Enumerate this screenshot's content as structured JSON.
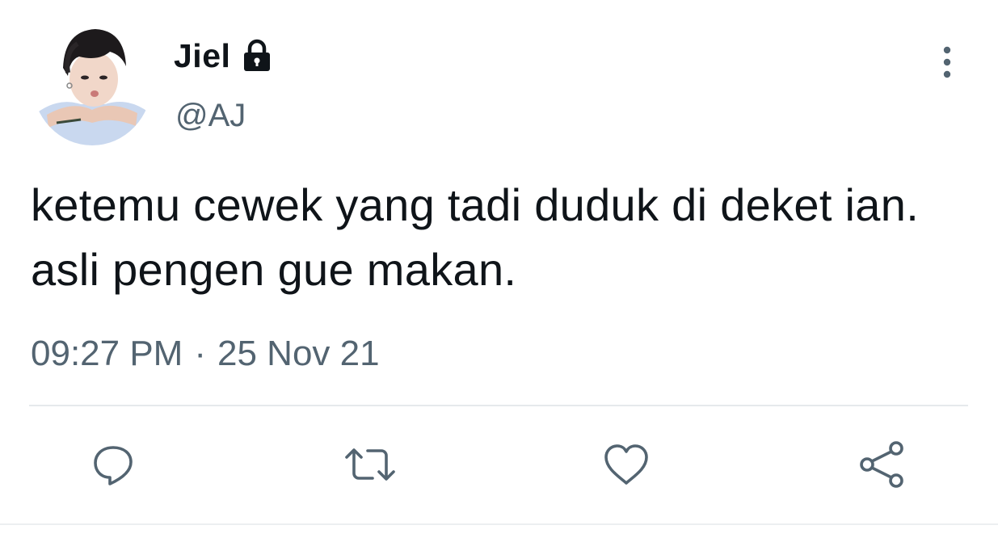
{
  "user": {
    "display_name": "Jiel",
    "handle": "@AJ",
    "protected_icon": "lock-icon",
    "avatar_icon": "avatar-photo"
  },
  "tweet": {
    "text": "ketemu cewek yang tadi duduk di deket ian. asli pengen gue makan.",
    "time": "09:27 PM",
    "separator": "·",
    "date": "25 Nov 21"
  },
  "actions": [
    {
      "name": "reply",
      "icon": "reply-icon"
    },
    {
      "name": "retweet",
      "icon": "retweet-icon"
    },
    {
      "name": "like",
      "icon": "heart-icon"
    },
    {
      "name": "share",
      "icon": "share-icon"
    }
  ],
  "colors": {
    "primary_text": "#0f1419",
    "secondary_text": "#536471",
    "icon": "#536471",
    "divider": "#e6e9ec"
  }
}
